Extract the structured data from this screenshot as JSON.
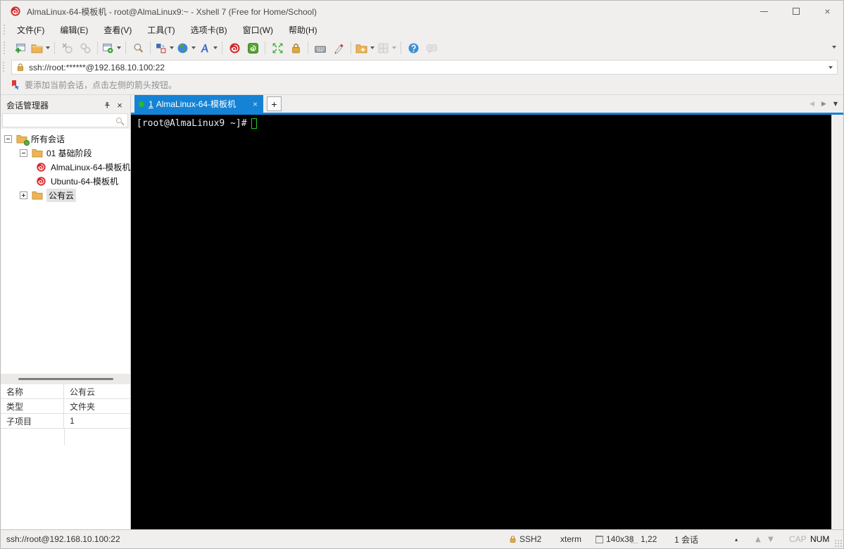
{
  "window": {
    "title": "AlmaLinux-64-模板机 - root@AlmaLinux9:~ - Xshell 7 (Free for Home/School)",
    "close_glyph": "×"
  },
  "colors": {
    "tab_active_blue": "#1583d5",
    "tab_dot_green": "#2db52d",
    "terminal_cursor_green": "#1ecb24",
    "xshell_red": "#d42a2a",
    "terminal_background": "#000000"
  },
  "menu": {
    "items": [
      "文件(F)",
      "编辑(E)",
      "查看(V)",
      "工具(T)",
      "选项卡(B)",
      "窗口(W)",
      "帮助(H)"
    ]
  },
  "toolbar": {
    "icons": [
      "new-session",
      "open-folder",
      "disconnect",
      "reconnect",
      "session-properties",
      "find",
      "arrange-layout",
      "web-browser",
      "font",
      "xshell",
      "xftp",
      "fullscreen",
      "lock-screen",
      "virtual-keyboard",
      "highlight-pen",
      "new-folder",
      "tile-windows",
      "help",
      "feedback"
    ]
  },
  "address_bar": {
    "value": "ssh://root:******@192.168.10.100:22"
  },
  "info_bar": {
    "text": "要添加当前会话，点击左侧的箭头按钮。"
  },
  "session_manager": {
    "title": "会话管理器",
    "search_placeholder": "",
    "tree": [
      {
        "label": "所有会话"
      },
      {
        "label": "01 基础阶段"
      },
      {
        "label": "AlmaLinux-64-模板机"
      },
      {
        "label": "Ubuntu-64-模板机"
      },
      {
        "label": "公有云"
      }
    ]
  },
  "properties": {
    "rows": [
      {
        "label": "名称",
        "value": "公有云"
      },
      {
        "label": "类型",
        "value": "文件夹"
      },
      {
        "label": "子项目",
        "value": "1"
      }
    ]
  },
  "tab_bar": {
    "active_tab": {
      "number": "1",
      "label": "AlmaLinux-64-模板机",
      "close": "×"
    },
    "new_tab": "+",
    "scroll_left": "◀",
    "scroll_right": "▶",
    "menu_arrow": "▼"
  },
  "terminal": {
    "prompt": "[root@AlmaLinux9 ~]#"
  },
  "status_bar": {
    "url": "ssh://root@192.168.10.100:22",
    "protocol": "SSH2",
    "terminal_type": "xterm",
    "size": "140x38",
    "cursor_position": "1,22",
    "session_count": "1 会话",
    "dropdown": "▴",
    "up_arrow": "▲",
    "down_arrow": "▼",
    "cap": "CAP",
    "num": "NUM"
  }
}
